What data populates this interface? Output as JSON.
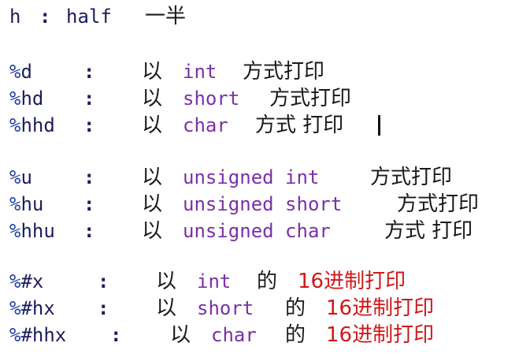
{
  "header": {
    "letter": "h",
    "colon": ":",
    "word": "half",
    "meaning": "一半"
  },
  "groups": [
    {
      "rows": [
        {
          "pct": "%",
          "spec": "d",
          "colon": ":",
          "prefix": "以",
          "type": "int",
          "suffix": "方式打印"
        },
        {
          "pct": "%",
          "spec": "hd",
          "colon": ":",
          "prefix": "以",
          "type": "short",
          "suffix": "方式打印"
        },
        {
          "pct": "%",
          "spec": "hhd",
          "colon": ":",
          "prefix": "以",
          "type": "char",
          "suffix": "方式 打印"
        }
      ]
    },
    {
      "rows": [
        {
          "pct": "%",
          "spec": "u",
          "colon": ":",
          "prefix": "以",
          "type": "unsigned int",
          "suffix": "方式打印"
        },
        {
          "pct": "%",
          "spec": "hu",
          "colon": ":",
          "prefix": "以",
          "type": "unsigned short",
          "suffix": "方式打印"
        },
        {
          "pct": "%",
          "spec": "hhu",
          "colon": ":",
          "prefix": "以",
          "type": "unsigned char",
          "suffix": "方式 打印"
        }
      ]
    },
    {
      "rows": [
        {
          "pct": "%",
          "spec": "#x",
          "colon": ":",
          "prefix": "以",
          "type": "int",
          "mid": "的",
          "suffix": "16进制打印"
        },
        {
          "pct": "%",
          "spec": "#hx",
          "colon": ":",
          "prefix": "以",
          "type": "short",
          "mid": "的",
          "suffix": "16进制打印"
        },
        {
          "pct": "%",
          "spec": "#hhx",
          "colon": ":",
          "prefix": "以",
          "type": "char",
          "mid": "的",
          "suffix": "16进制打印"
        }
      ]
    }
  ],
  "colors": {
    "format": "#1c1c5e",
    "percent": "#1f3fa0",
    "type_keyword": "#7b2fa8",
    "hex_note": "#d01818",
    "text": "#1a1a1a"
  }
}
